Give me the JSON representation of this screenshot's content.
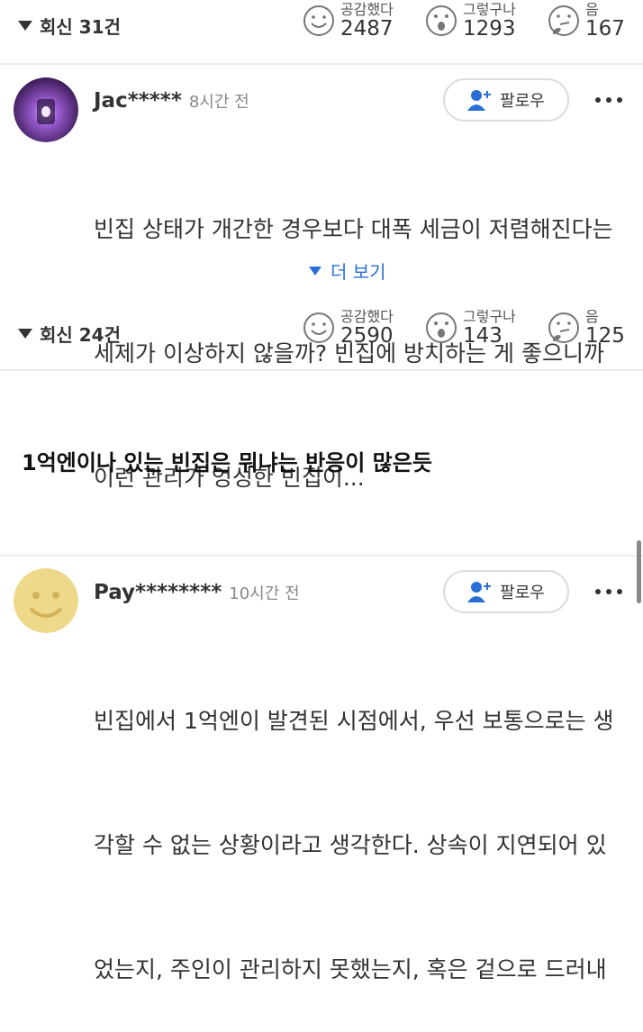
{
  "comments": [
    {
      "replies": {
        "label": "회신 31건"
      },
      "reactions": [
        {
          "label": "공감했다",
          "count": "2487",
          "icon": "smile-face-icon"
        },
        {
          "label": "그렇구나",
          "count": "1293",
          "icon": "surprised-face-icon"
        },
        {
          "label": "음",
          "count": "167",
          "icon": "thinking-face-icon"
        }
      ]
    },
    {
      "author": "Jac*****",
      "time": "8시간 전",
      "follow_label": "팔로우",
      "text_lines": [
        "빈집 상태가 개간한 경우보다 대폭 세금이 저렴해진다는",
        "세제가 이상하지 않을까? 빈집에 방치하는 게 좋으니까",
        "이런 관리가 엉성한 빈집이..."
      ],
      "more_label": "더 보기",
      "replies": {
        "label": "회신 24건"
      },
      "reactions": [
        {
          "label": "공감했다",
          "count": "2590",
          "icon": "smile-face-icon"
        },
        {
          "label": "그렇구나",
          "count": "143",
          "icon": "surprised-face-icon"
        },
        {
          "label": "음",
          "count": "125",
          "icon": "thinking-face-icon"
        }
      ]
    },
    {
      "author": "Pay********",
      "time": "10시간 전",
      "follow_label": "팔로우",
      "text_lines": [
        "빈집에서 1억엔이 발견된 시점에서, 우선 보통으로는 생",
        "각할 수 없는 상황이라고 생각한다. 상속이 지연되어 있",
        "었는지, 주인이 관리하지 못했는지, 혹은 겉으로 드러내"
      ]
    }
  ],
  "caption": "1억엔이나 있는 빈집은 뭐냐는 반응이 많은듯",
  "colors": {
    "accent": "#2a6fd6",
    "divider": "#ececec",
    "text": "#333333"
  }
}
